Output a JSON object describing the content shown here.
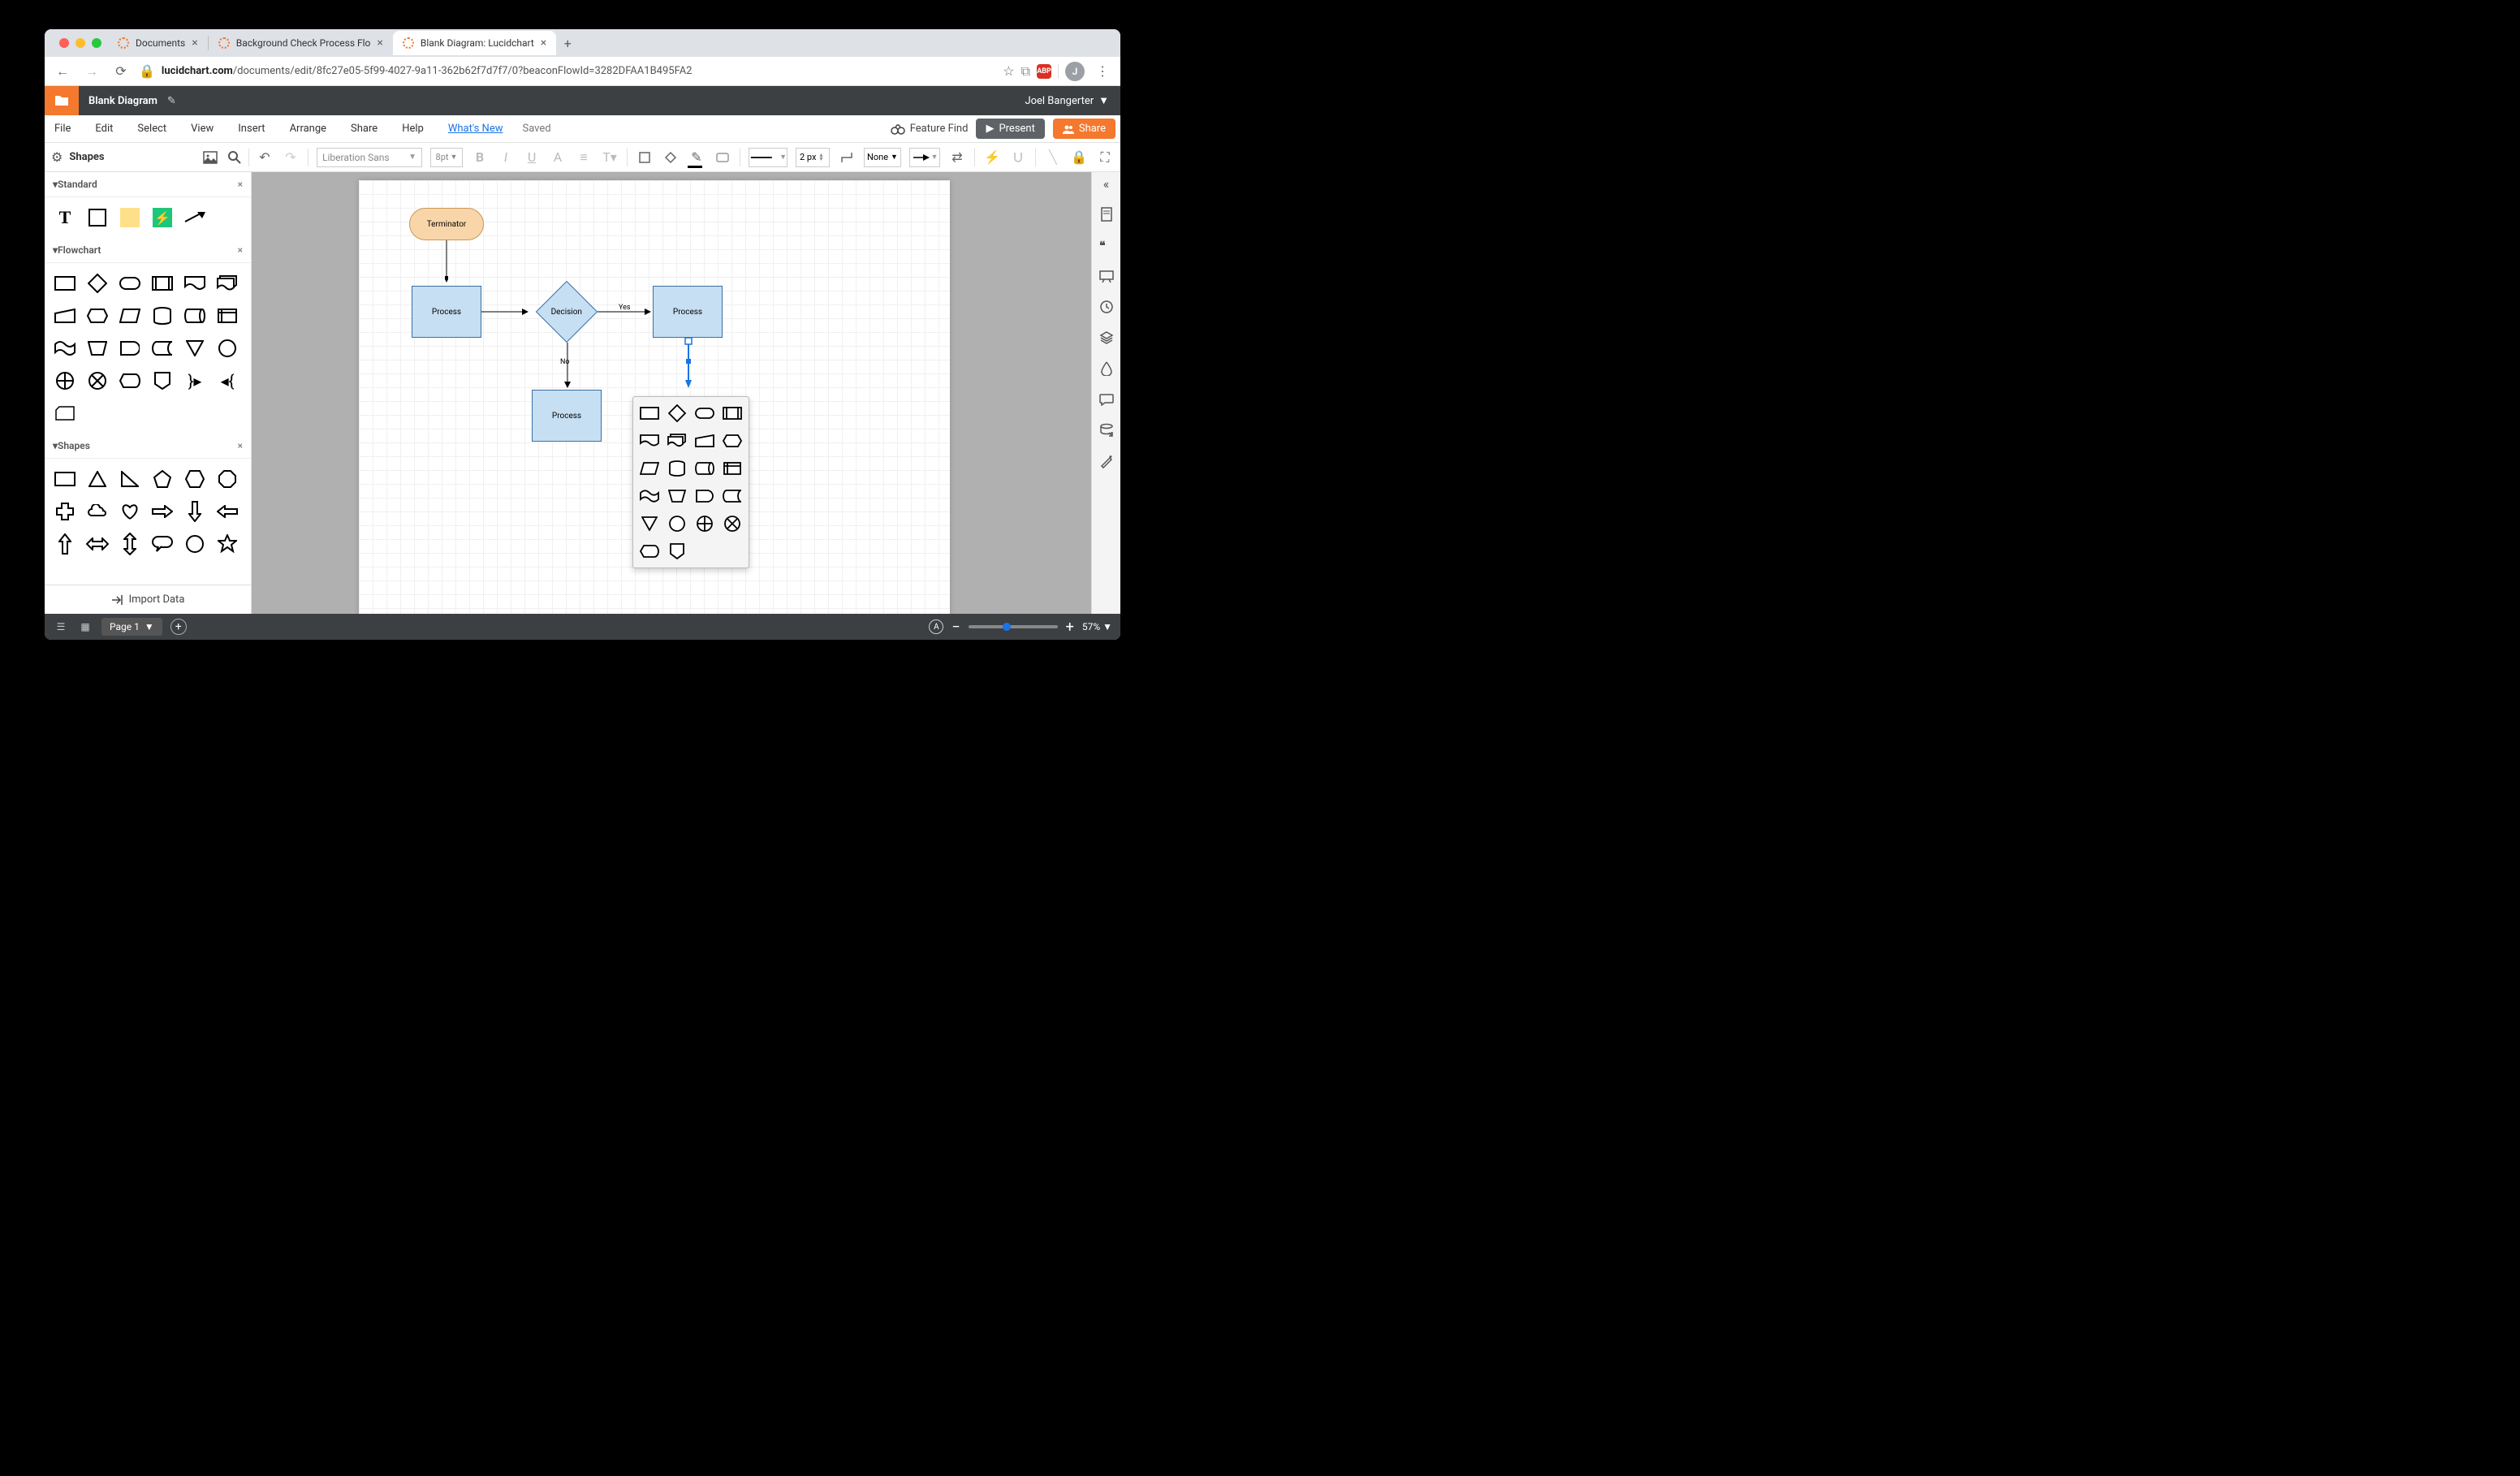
{
  "browser": {
    "tabs": [
      {
        "label": "Documents",
        "active": false
      },
      {
        "label": "Background Check Process Flo",
        "active": false
      },
      {
        "label": "Blank Diagram: Lucidchart",
        "active": true
      }
    ],
    "url_prefix": "lucidchart.com",
    "url_path": "/documents/edit/8fc27e05-5f99-4027-9a11-362b62f7d7f7/0?beaconFlowId=3282DFAA1B495FA2",
    "ext": "ABP",
    "avatar": "J"
  },
  "app": {
    "doc_title": "Blank Diagram",
    "user_name": "Joel Bangerter"
  },
  "menubar": {
    "items": [
      "File",
      "Edit",
      "Select",
      "View",
      "Insert",
      "Arrange",
      "Share",
      "Help"
    ],
    "whatsnew": "What's New",
    "saved": "Saved",
    "feature_find": "Feature Find",
    "present": "Present",
    "share": "Share"
  },
  "toolbar": {
    "shapes_label": "Shapes",
    "font": "Liberation Sans",
    "font_size": "8pt",
    "line_width": "2 px",
    "arrow_start": "None"
  },
  "sidebar": {
    "standard": "Standard",
    "flowchart": "Flowchart",
    "shapes": "Shapes",
    "import_data": "Import Data"
  },
  "canvas": {
    "nodes": {
      "terminator": "Terminator",
      "process1": "Process",
      "decision": "Decision",
      "process2": "Process",
      "process3": "Process"
    },
    "edges": {
      "yes": "Yes",
      "no": "No"
    }
  },
  "bottombar": {
    "page": "Page 1",
    "zoom": "57%"
  }
}
